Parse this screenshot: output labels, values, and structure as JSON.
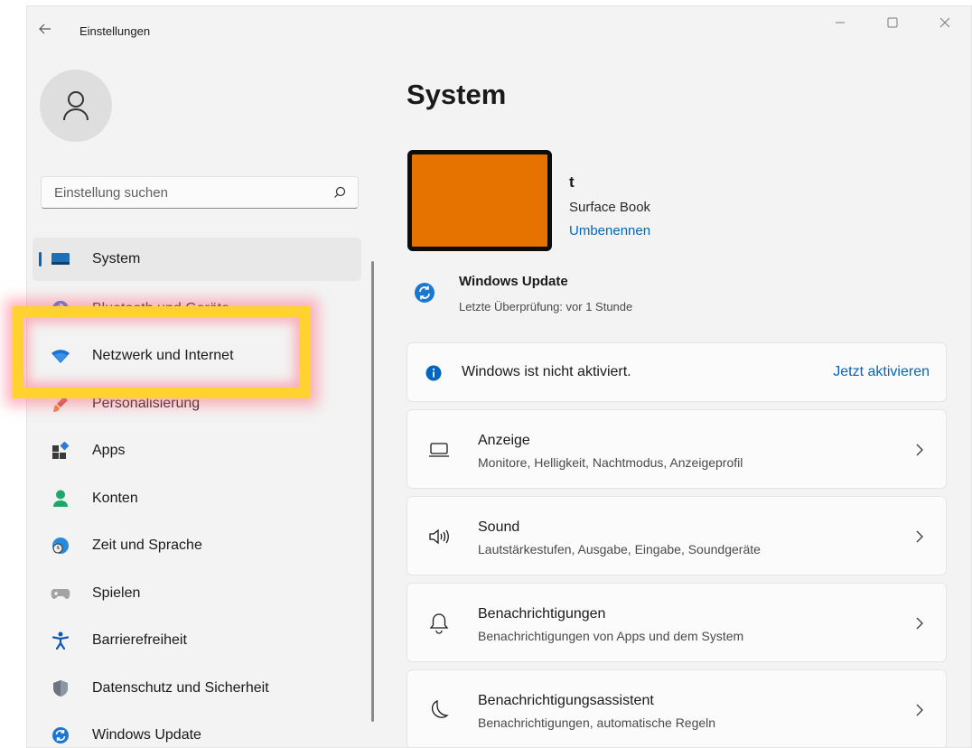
{
  "window": {
    "title": "Einstellungen",
    "controls": [
      "minimize-icon",
      "maximize-icon",
      "close-icon"
    ]
  },
  "sidebar": {
    "search_placeholder": "Einstellung suchen",
    "items": [
      {
        "label": "System",
        "icon": "monitor-icon",
        "active": true
      },
      {
        "label": "Bluetooth und Geräte",
        "icon": "bluetooth-icon"
      },
      {
        "label": "Netzwerk und Internet",
        "icon": "wifi-icon",
        "highlighted": true
      },
      {
        "label": "Personalisierung",
        "icon": "brush-icon"
      },
      {
        "label": "Apps",
        "icon": "apps-icon"
      },
      {
        "label": "Konten",
        "icon": "person-icon"
      },
      {
        "label": "Zeit und Sprache",
        "icon": "globe-clock-icon"
      },
      {
        "label": "Spielen",
        "icon": "gamepad-icon"
      },
      {
        "label": "Barrierefreiheit",
        "icon": "accessibility-icon"
      },
      {
        "label": "Datenschutz und Sicherheit",
        "icon": "shield-icon"
      },
      {
        "label": "Windows Update",
        "icon": "update-icon"
      }
    ]
  },
  "main": {
    "title": "System",
    "device": {
      "name": "t",
      "model": "Surface Book",
      "rename_label": "Umbenennen"
    },
    "windows_update": {
      "title": "Windows Update",
      "subtitle": "Letzte Überprüfung: vor 1 Stunde"
    },
    "activation": {
      "text": "Windows ist nicht aktiviert.",
      "link": "Jetzt aktivieren"
    },
    "settings": [
      {
        "title": "Anzeige",
        "desc": "Monitore, Helligkeit, Nachtmodus, Anzeigeprofil",
        "icon": "display-icon"
      },
      {
        "title": "Sound",
        "desc": "Lautstärkestufen, Ausgabe, Eingabe, Soundgeräte",
        "icon": "speaker-icon"
      },
      {
        "title": "Benachrichtigungen",
        "desc": "Benachrichtigungen von Apps und dem System",
        "icon": "bell-icon"
      },
      {
        "title": "Benachrichtigungsassistent",
        "desc": "Benachrichtigungen, automatische Regeln",
        "icon": "moon-icon"
      }
    ]
  },
  "colors": {
    "accent": "#0067c0",
    "device_color": "#e67300",
    "highlight": "#ffd230"
  }
}
